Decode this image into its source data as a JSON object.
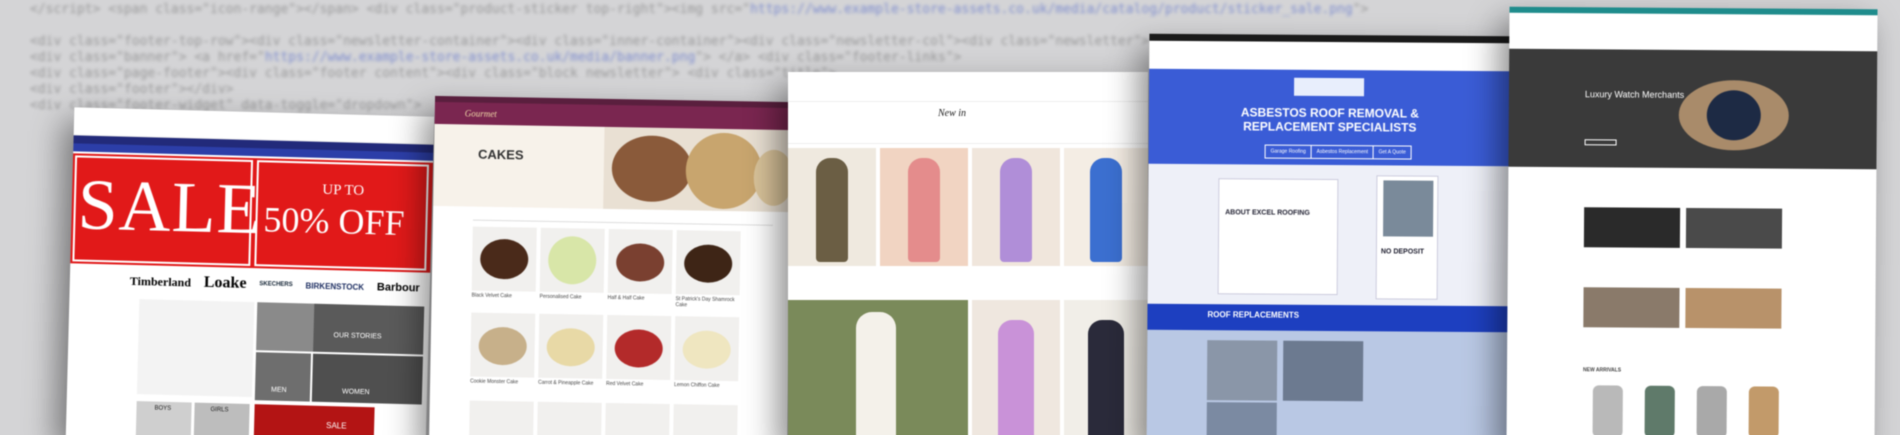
{
  "shot1": {
    "sale_word": "SALE",
    "upto": "UP TO",
    "percent": "50% OFF",
    "brands": [
      "Timberland",
      "Loake",
      "SKECHERS",
      "BIRKENSTOCK",
      "Barbour"
    ],
    "tile_labels": [
      "OUR STORIES",
      "MEN",
      "WOMEN"
    ],
    "bottom_labels": [
      "BOYS",
      "GIRLS",
      "SALE"
    ]
  },
  "shot2": {
    "logo": "Gourmet",
    "heading": "CAKES",
    "products": [
      {
        "name": "Black Velvet Cake"
      },
      {
        "name": "Personalised Cake"
      },
      {
        "name": "Half & Half Cake"
      },
      {
        "name": "St Patrick's Day Shamrock Cake"
      },
      {
        "name": "Cookie Monster Cake"
      },
      {
        "name": "Carrot & Pineapple Cake"
      },
      {
        "name": "Red Velvet Cake"
      },
      {
        "name": "Lemon Chiffon Cake"
      }
    ]
  },
  "shot3": {
    "heading": "New in"
  },
  "shot4": {
    "hero_title_1": "ASBESTOS ROOF REMOVAL &",
    "hero_title_2": "REPLACEMENT SPECIALISTS",
    "buttons": [
      "Garage Roofing",
      "Asbestos Replacement",
      "Get A Quote"
    ],
    "about_title": "ABOUT EXCEL ROOFING",
    "no_deposit": "NO DEPOSIT",
    "band_title": "ROOF REPLACEMENTS"
  },
  "shot5": {
    "hero_title": "Luxury Watch Merchants",
    "section_label": "NEW ARRIVALS"
  }
}
